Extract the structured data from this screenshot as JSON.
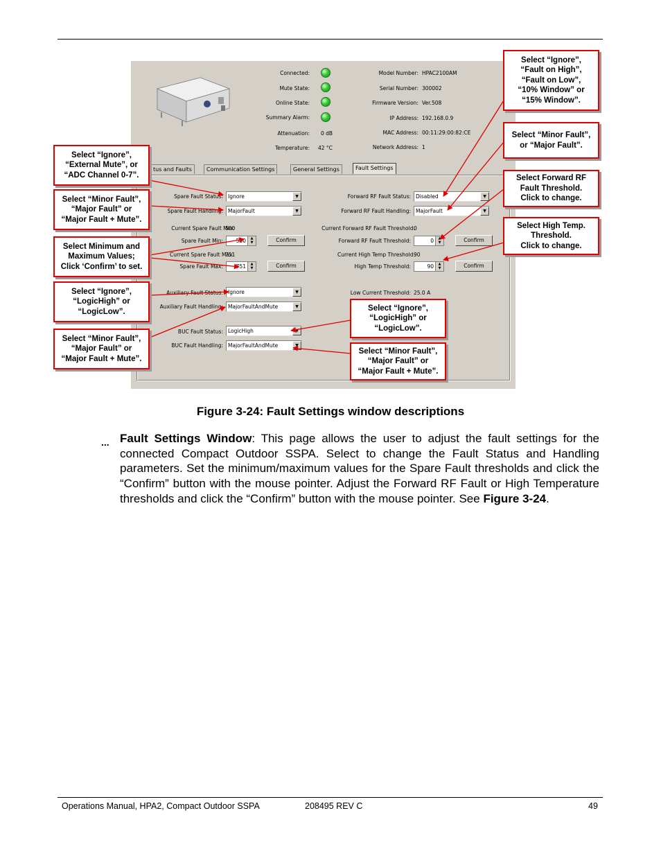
{
  "screenshot": {
    "status": [
      {
        "label": "Connected:"
      },
      {
        "label": "Mute State:"
      },
      {
        "label": "Online State:"
      },
      {
        "label": "Summary Alarm:"
      }
    ],
    "left_info": [
      {
        "label": "Attenuation:",
        "value": "0 dB"
      },
      {
        "label": "Temperature:",
        "value": "42 °C"
      }
    ],
    "right_info": [
      {
        "label": "Model Number:",
        "value": "HPAC2100AM"
      },
      {
        "label": "Serial Number:",
        "value": "300002"
      },
      {
        "label": "Firmware Version:",
        "value": "Ver.508"
      },
      {
        "label": "IP Address:",
        "value": "192.168.0.9"
      },
      {
        "label": "MAC Address:",
        "value": "00:11:29:00:82:CE"
      },
      {
        "label": "Network Address:",
        "value": "1"
      }
    ],
    "tabs": [
      "tus and Faults",
      "Communication Settings",
      "General Settings",
      "Fault Settings"
    ],
    "form": {
      "spare_fault_status_label": "Spare Fault Status:",
      "spare_fault_status_value": "Ignore",
      "spare_fault_handling_label": "Spare Fault Handling:",
      "spare_fault_handling_value": "MajorFault",
      "current_spare_fault_min": "Current Spare Fault Min:",
      "current_spare_fault_min_value": "500",
      "spare_fault_min_label": "Spare Fault Min:",
      "spare_fault_min_value": "500",
      "current_spare_fault_max": "Current Spare Fault Max:",
      "current_spare_fault_max_value": "751",
      "spare_fault_max_label": "Spare Fault Max:",
      "spare_fault_max_value": "751",
      "fwd_rf_status_label": "Forward RF Fault Status:",
      "fwd_rf_status_value": "Disabled",
      "fwd_rf_handling_label": "Forward RF Fault Handling:",
      "fwd_rf_handling_value": "MajorFault",
      "current_fwd_rf_threshold": "Current Forward RF Fault Threshold:",
      "current_fwd_rf_threshold_value": "0",
      "fwd_rf_threshold_label": "Forward RF Fault Threshold:",
      "fwd_rf_threshold_value": "0",
      "current_high_temp": "Current High Temp Threshold:",
      "current_high_temp_value": "90",
      "high_temp_label": "High Temp Threshold:",
      "high_temp_value": "90",
      "confirm": "Confirm",
      "aux_status_label": "Auxiliary Fault Status:",
      "aux_status_value": "Ignore",
      "aux_handling_label": "Auxiliary Fault Handling:",
      "aux_handling_value": "MajorFaultAndMute",
      "low_current_label": "Low Current Threshold:",
      "low_current_value": "25.0 A",
      "buc_status_label": "BUC Fault Status:",
      "buc_status_value": "LogicHigh",
      "buc_handling_label": "BUC Fault Handling:",
      "buc_handling_value": "MajorFaultAndMute"
    }
  },
  "callouts": {
    "fwd_status": "Select “Ignore”,\n“Fault on High”,\n“Fault on Low”,\n“10% Window” or\n“15% Window”.",
    "fwd_handling": "Select “Minor Fault”,\nor “Major Fault”.",
    "fwd_threshold": "Select Forward RF\nFault Threshold.\nClick to change.",
    "high_temp": "Select High Temp.\nThreshold.\nClick to change.",
    "spare_status": "Select “Ignore”,\n“External Mute”, or\n“ADC Channel 0-7”.",
    "spare_handling": "Select “Minor Fault”,\n“Major Fault” or\n“Major Fault + Mute”.",
    "min_max": "Select Minimum and\nMaximum Values;\nClick ‘Confirm’ to set.",
    "aux_status": "Select “Ignore”,\n“LogicHigh” or\n“LogicLow”.",
    "aux_handling": "Select “Minor Fault”,\n“Major Fault” or\n“Major Fault + Mute”.",
    "buc_status": "Select “Ignore”,\n“LogicHigh” or\n“LogicLow”.",
    "buc_handling": "Select “Minor Fault”,\n“Major Fault” or\n“Major Fault + Mute”."
  },
  "caption": "Figure 3-24: Fault Settings window descriptions",
  "body": {
    "bullet": "...",
    "title": "Fault Settings Window",
    "text": ": This page allows the user to adjust the fault settings for the connected Compact Outdoor SSPA. Select to change the Fault Status and Handling parameters. Set the minimum/maximum values for the Spare Fault thresholds and click the “Confirm” button with the mouse pointer. Adjust the Forward RF Fault or High Temperature thresholds and click the “Confirm” button with the mouse pointer. See ",
    "ref": "Figure 3-24",
    "end": "."
  },
  "footer": {
    "left": "Operations Manual, HPA2, Compact Outdoor SSPA",
    "center": "208495 REV C",
    "right": "49"
  },
  "colors": {
    "callout_border": "#e00000",
    "led_green": "#33cc33",
    "window_bg": "#d4d0c8"
  }
}
